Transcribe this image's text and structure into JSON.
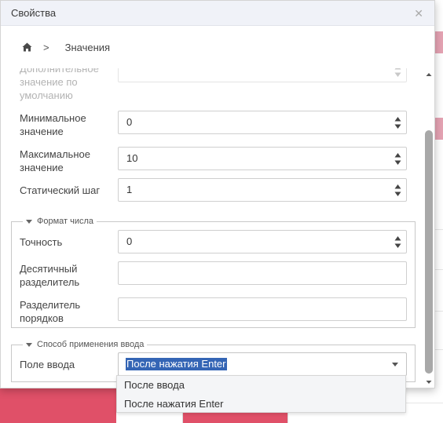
{
  "dialog": {
    "title": "Свойства",
    "close_icon": "close-icon"
  },
  "breadcrumb": {
    "home_icon": "home-icon",
    "separator": ">",
    "current": "Значения"
  },
  "fields": {
    "default_value": {
      "label": "Дополнительное значение по умолчанию",
      "value": ""
    },
    "min_value": {
      "label": "Минимальное значение",
      "value": "0"
    },
    "max_value": {
      "label": "Максимальное значение",
      "value": "10"
    },
    "static_step": {
      "label": "Статический шаг",
      "value": "1"
    }
  },
  "number_format": {
    "legend": "Формат числа",
    "precision": {
      "label": "Точность",
      "value": "0"
    },
    "decimal_separator": {
      "label": "Десятичный разделитель",
      "value": ""
    },
    "group_separator": {
      "label": "Разделитель порядков",
      "value": ""
    }
  },
  "input_mode": {
    "legend": "Способ применения ввода",
    "field_label": "Поле ввода",
    "selected": "После нажатия Enter",
    "options": [
      "После ввода",
      "После нажатия Enter"
    ]
  },
  "colors": {
    "accent_red": "#e05068",
    "selection_blue": "#3465b5",
    "header_bg": "#f0f2f8"
  }
}
